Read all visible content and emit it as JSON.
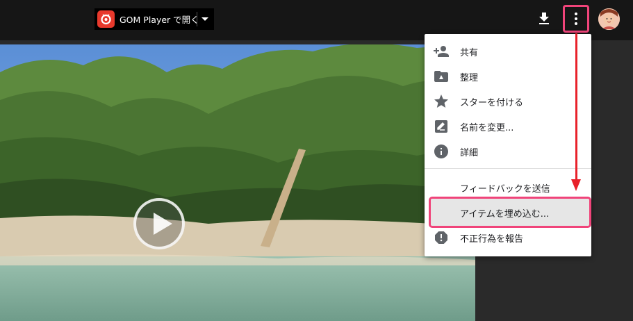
{
  "toolbar": {
    "open_with_label": "GOM Player で開く",
    "download_icon": "download-icon",
    "more_icon": "more-vert-icon",
    "avatar": "user-avatar",
    "highlight_color": "#f0447a"
  },
  "menu": {
    "items": [
      {
        "label": "共有",
        "icon": "person-add-icon"
      },
      {
        "label": "整理",
        "icon": "folder-move-icon"
      },
      {
        "label": "スターを付ける",
        "icon": "star-icon"
      },
      {
        "label": "名前を変更...",
        "icon": "rename-icon"
      },
      {
        "label": "詳細",
        "icon": "info-icon"
      },
      {
        "label": "フィードバックを送信",
        "icon": ""
      },
      {
        "label": "アイテムを埋め込む...",
        "icon": ""
      },
      {
        "label": "不正行為を報告",
        "icon": "report-icon"
      }
    ]
  },
  "annotation": {
    "arrow_color": "#e8212a"
  }
}
